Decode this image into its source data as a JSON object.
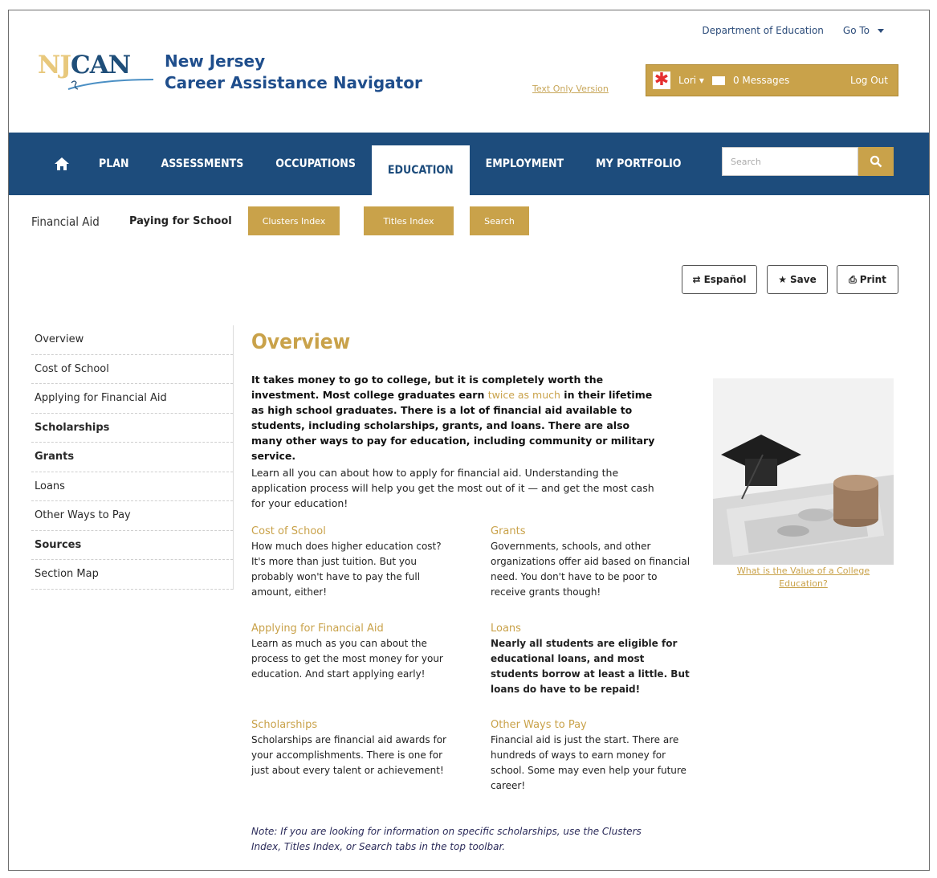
{
  "header": {
    "logo_text_nj": "NJ",
    "logo_text_can": "CAN",
    "brand_line1": "New Jersey",
    "brand_line2": "Career Assistance Navigator",
    "dept_link": "Department of Education",
    "goto_label": "Go To",
    "text_only_link": "Text Only Version",
    "user_name": "Lori",
    "messages_label": "0 Messages",
    "logout_label": "Log Out"
  },
  "nav": {
    "items": [
      "PLAN",
      "ASSESSMENTS",
      "OCCUPATIONS",
      "EDUCATION",
      "EMPLOYMENT",
      "MY PORTFOLIO"
    ],
    "active": "EDUCATION",
    "search_placeholder": "Search"
  },
  "subnav": {
    "title": "Financial Aid",
    "link": "Paying for School",
    "buttons": [
      "Clusters Index",
      "Titles Index",
      "Search"
    ]
  },
  "utility": {
    "espanol": "Español",
    "save": "Save",
    "print": "Print"
  },
  "sidebar": {
    "items": [
      {
        "label": "Overview",
        "bold": false
      },
      {
        "label": "Cost of School",
        "bold": false
      },
      {
        "label": "Applying for Financial Aid",
        "bold": false
      },
      {
        "label": "Scholarships",
        "bold": true
      },
      {
        "label": "Grants",
        "bold": true
      },
      {
        "label": "Loans",
        "bold": false
      },
      {
        "label": "Other Ways to Pay",
        "bold": false
      },
      {
        "label": "Sources",
        "bold": true
      },
      {
        "label": "Section Map",
        "bold": false
      }
    ]
  },
  "main": {
    "title": "Overview",
    "intro_pre": "It takes money to go to college, but it is completely worth the investment. Most college graduates earn",
    "intro_link": "twice as much",
    "intro_post": "in their lifetime as high school graduates. There is a lot of financial aid available to students, including scholarships, grants, and loans. There are also many other ways to pay for education, including community or military service.",
    "intro2": "Learn all you can about how to apply for financial aid. Understanding the application process will help you get the most out of it — and get the most cash for your education!",
    "cards": [
      {
        "title": "Cost of School",
        "body": "How much does higher education cost? It's more than just tuition. But you probably won't have to pay the full amount, either!"
      },
      {
        "title": "Grants",
        "body": "Governments, schools, and other organizations offer aid based on financial need. You don't have to be poor to receive grants though!"
      },
      {
        "title": "Applying for Financial Aid",
        "body": "Learn as much as you can about the process to get the most money for your education. And start applying early!"
      },
      {
        "title": "Loans",
        "body": "Nearly all students are eligible for educational loans, and most students borrow at least a little. But loans do have to be repaid!"
      },
      {
        "title": "Scholarships",
        "body": "Scholarships are financial aid awards for your accomplishments. There is one for just about every talent or achievement!"
      },
      {
        "title": "Other Ways to Pay",
        "body": "Financial aid is just the start. There are hundreds of ways to earn money for school. Some may even help your future career!"
      }
    ],
    "note": "Note: If you are looking for information on specific scholarships, use the Clusters Index, Titles Index, or Search tabs in the top toolbar.",
    "photo_caption": "What is the Value of a College Education?"
  },
  "colors": {
    "navy": "#1d4c7c",
    "gold": "#c9a24a",
    "brand_blue": "#1f4e8c"
  }
}
